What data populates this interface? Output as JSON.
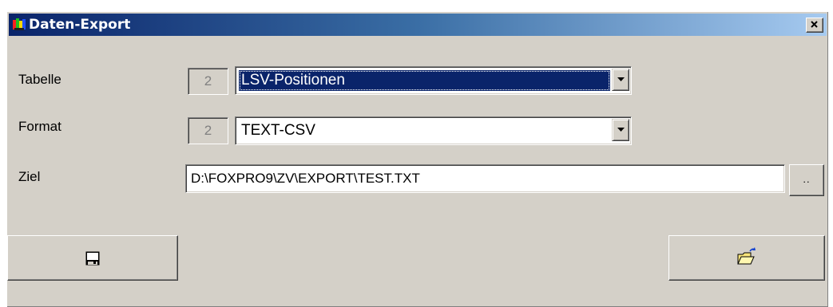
{
  "window": {
    "title": "Daten-Export",
    "icon": "colorful-app-icon",
    "close_icon": "close-icon"
  },
  "form": {
    "tabelle": {
      "label": "Tabelle",
      "id": "2",
      "value": "LSV-Positionen",
      "selected": true
    },
    "format": {
      "label": "Format",
      "id": "2",
      "value": "TEXT-CSV",
      "selected": false
    },
    "ziel": {
      "label": "Ziel",
      "value": "D:\\FOXPRO9\\ZV\\EXPORT\\TEST.TXT",
      "browse_label": ".."
    }
  },
  "buttons": {
    "save_icon": "floppy-disk-icon",
    "open_icon": "open-folder-icon"
  },
  "colors": {
    "dialog_bg": "#d4d0c8",
    "title_start": "#0a246a",
    "title_end": "#a6caf0",
    "selection": "#0a246a"
  }
}
